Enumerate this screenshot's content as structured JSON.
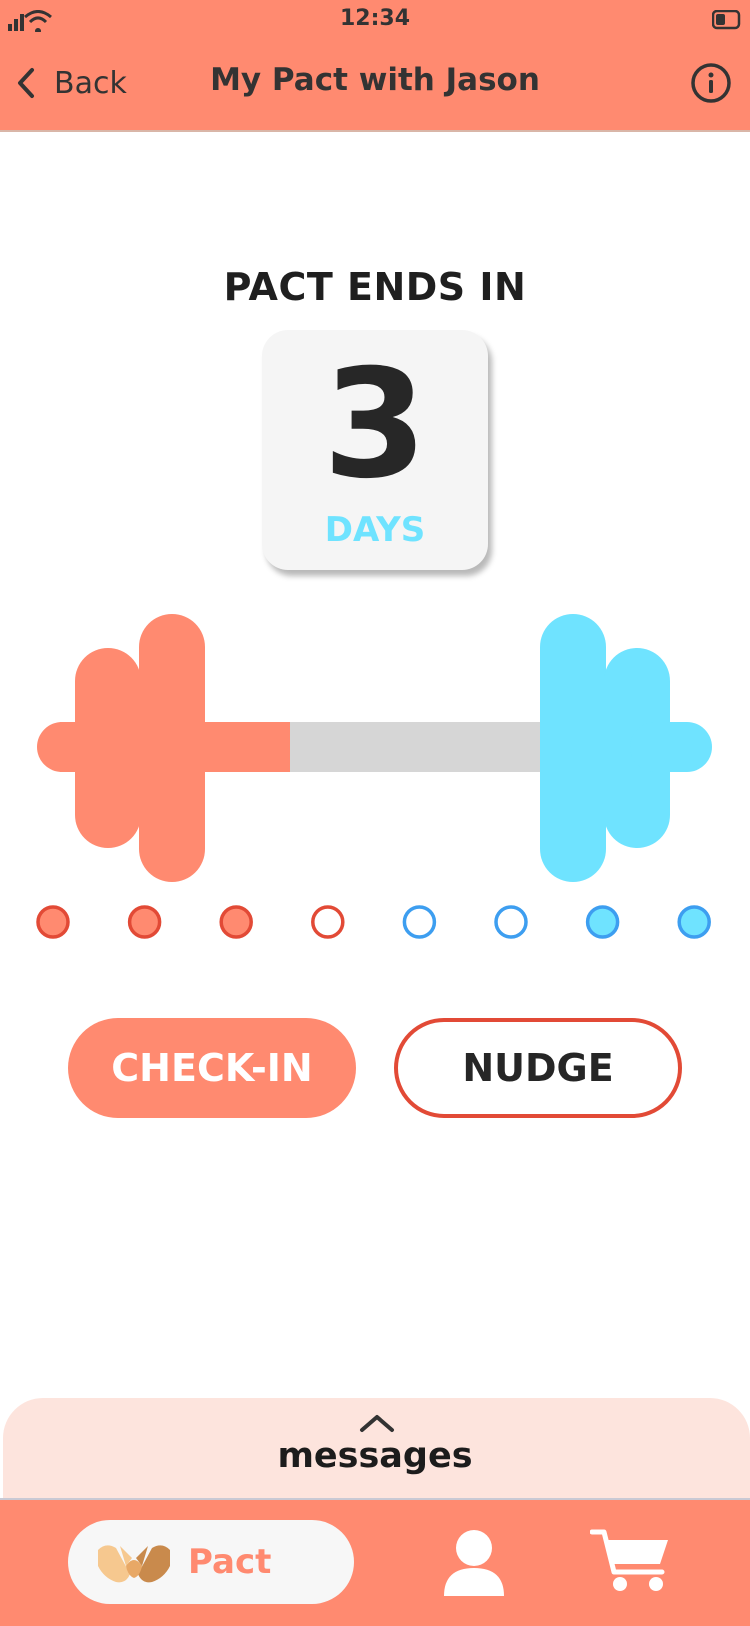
{
  "colors": {
    "accent": "#ff8a70",
    "blue": "#6fe3ff",
    "red": "#e24a36",
    "dot_blue_stroke": "#3d9ef0",
    "bar_grey": "#d6d6d6"
  },
  "status_bar": {
    "time": "12:34"
  },
  "header": {
    "back_label": "Back",
    "title": "My Pact with Jason",
    "info_icon": "info-icon"
  },
  "countdown": {
    "heading": "PACT ENDS IN",
    "number": "3",
    "unit": "DAYS"
  },
  "progress": {
    "user_progress_fraction": 0.41,
    "dots": [
      {
        "side": "user",
        "filled": true
      },
      {
        "side": "user",
        "filled": true
      },
      {
        "side": "user",
        "filled": true
      },
      {
        "side": "user",
        "filled": false
      },
      {
        "side": "partner",
        "filled": false
      },
      {
        "side": "partner",
        "filled": false
      },
      {
        "side": "partner",
        "filled": true
      },
      {
        "side": "partner",
        "filled": true
      }
    ]
  },
  "actions": {
    "checkin_label": "CHECK-IN",
    "nudge_label": "NUDGE"
  },
  "messages": {
    "label": "messages",
    "icon": "chevron-up-icon"
  },
  "tabbar": {
    "pact_label": "Pact",
    "icons": [
      "handshake-icon",
      "profile-icon",
      "cart-icon"
    ]
  }
}
